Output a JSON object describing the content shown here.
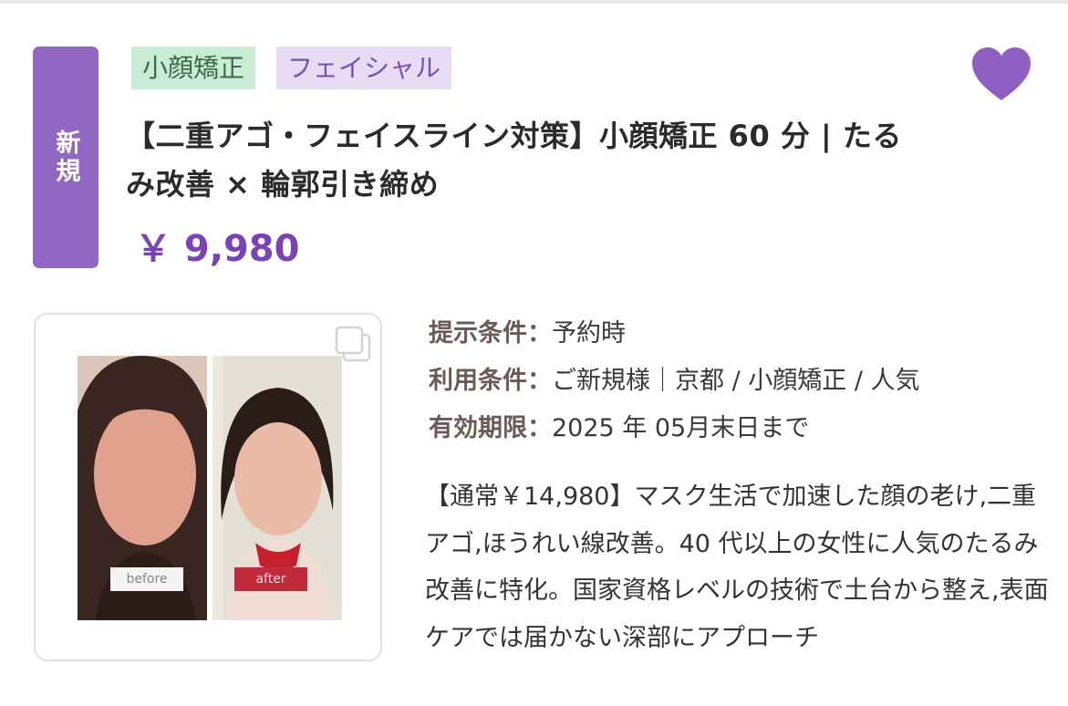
{
  "badge": {
    "label": "新規"
  },
  "tags": [
    {
      "label": "小顔矯正",
      "bg": "#c9ecd4",
      "fg": "#3c6b4c"
    },
    {
      "label": "フェイシャル",
      "bg": "#e7dcf4",
      "fg": "#7c4fb3"
    }
  ],
  "favorite": {
    "icon": "heart-icon",
    "color": "#8f5fc4"
  },
  "coupon": {
    "title": "【二重アゴ・フェイスライン対策】小顔矯正 60 分 | たるみ改善 × 輪郭引き締め",
    "price": "￥ 9,980"
  },
  "image": {
    "gallery_icon": "multiple-images-icon",
    "before_label": "before",
    "after_label": "after"
  },
  "conditions": [
    {
      "label": "提示条件：",
      "value": "予約時"
    },
    {
      "label": "利用条件：",
      "value": "ご新規様｜京都 / 小顔矯正 / 人気"
    },
    {
      "label": "有効期限：",
      "value": "2025 年 05月末日まで"
    }
  ],
  "description": "【通常￥14,980】マスク生活で加速した顔の老け,二重アゴ,ほうれい線改善。40 代以上の女性に人気のたるみ改善に特化。国家資格レベルの技術で土台から整え,表面ケアでは届かない深部にアプローチ",
  "colors": {
    "accent": "#9266c3",
    "price": "#7b43b6"
  }
}
